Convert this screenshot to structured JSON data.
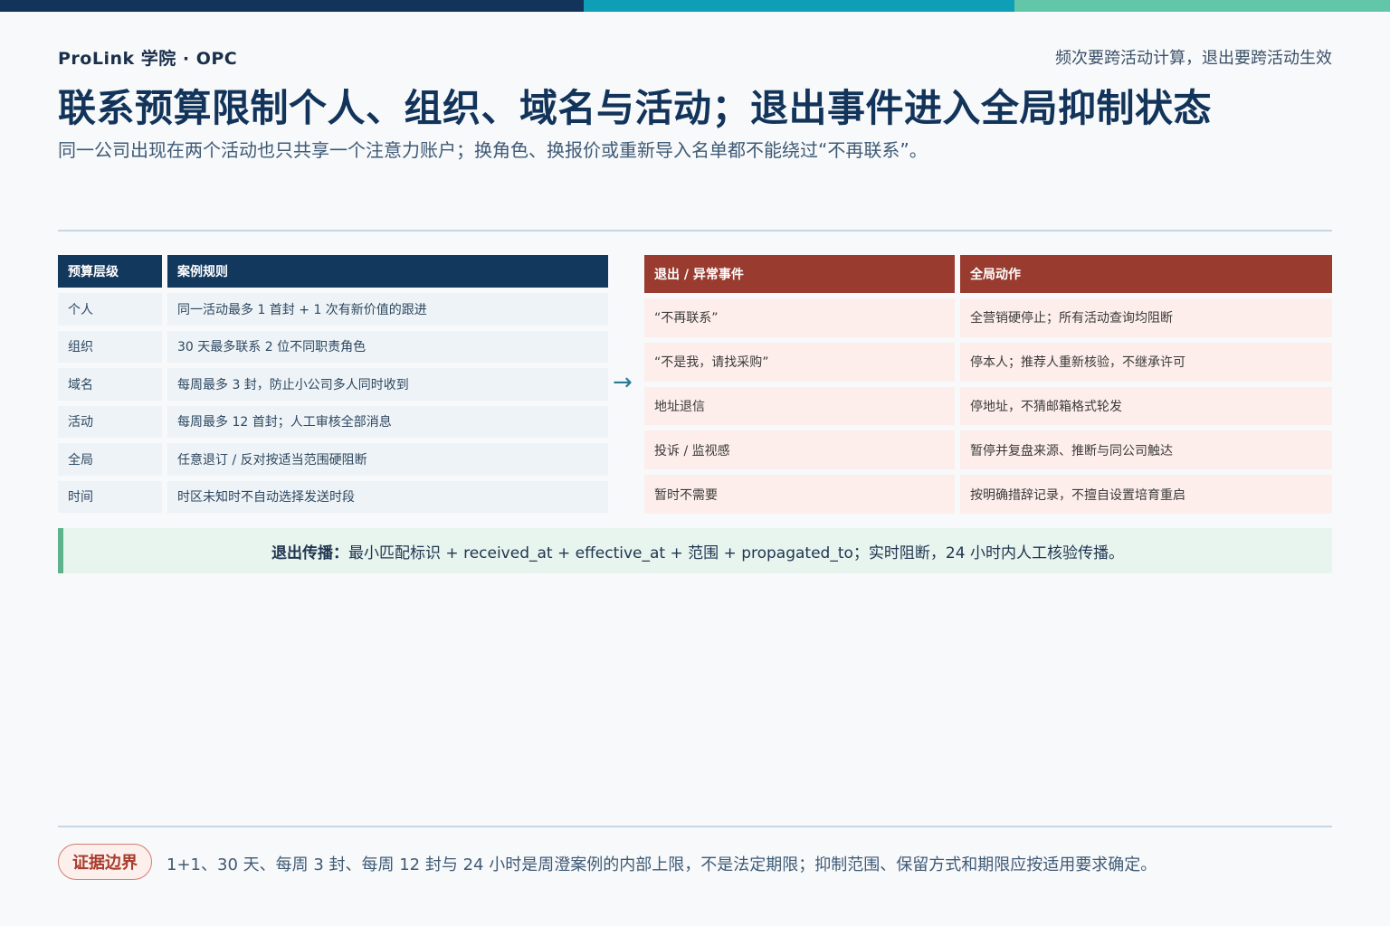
{
  "colors": {
    "topbar": [
      "#13345a",
      "#0e9fb6",
      "#62c6a8"
    ],
    "navy": "#13385e",
    "brick": "#993c2f",
    "green": "#5cb38c"
  },
  "header": {
    "brand": "ProLink 学院 · OPC",
    "tagline": "频次要跨活动计算，退出要跨活动生效",
    "title": "联系预算限制个人、组织、域名与活动；退出事件进入全局抑制状态",
    "subtitle": "同一公司出现在两个活动也只共享一个注意力账户；换角色、换报价或重新导入名单都不能绕过“不再联系”。"
  },
  "budget_table": {
    "headers": [
      "预算层级",
      "案例规则"
    ],
    "rows": [
      [
        "个人",
        "同一活动最多 1 首封 + 1 次有新价值的跟进"
      ],
      [
        "组织",
        "30 天最多联系 2 位不同职责角色"
      ],
      [
        "域名",
        "每周最多 3 封，防止小公司多人同时收到"
      ],
      [
        "活动",
        "每周最多 12 首封；人工审核全部消息"
      ],
      [
        "全局",
        "任意退订 / 反对按适当范围硬阻断"
      ],
      [
        "时间",
        "时区未知时不自动选择发送时段"
      ]
    ]
  },
  "arrow": "→",
  "exit_table": {
    "headers": [
      "退出 / 异常事件",
      "全局动作"
    ],
    "rows": [
      [
        "“不再联系”",
        "全营销硬停止；所有活动查询均阻断"
      ],
      [
        "“不是我，请找采购”",
        "停本人；推荐人重新核验，不继承许可"
      ],
      [
        "地址退信",
        "停地址，不猜邮箱格式轮发"
      ],
      [
        "投诉 / 监视感",
        "暂停并复盘来源、推断与同公司触达"
      ],
      [
        "暂时不需要",
        "按明确措辞记录，不擅自设置培育重启"
      ]
    ]
  },
  "callout": {
    "label": "退出传播：",
    "text": "最小匹配标识 + received_at + effective_at + 范围 + propagated_to；实时阻断，24 小时内人工核验传播。"
  },
  "footer": {
    "badge": "证据边界",
    "text": "1+1、30 天、每周 3 封、每周 12 封与 24 小时是周澄案例的内部上限，不是法定期限；抑制范围、保留方式和期限应按适用要求确定。"
  }
}
